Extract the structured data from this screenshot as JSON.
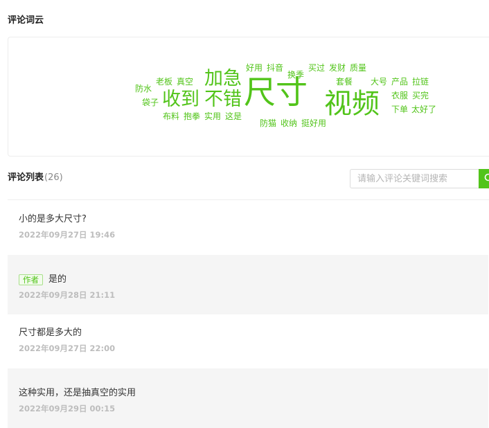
{
  "cloud_section": {
    "title": "评论词云",
    "words": [
      {
        "text": "尺寸",
        "size": 46
      },
      {
        "text": "视频",
        "size": 40
      },
      {
        "text": "收到",
        "size": 27
      },
      {
        "text": "不错",
        "size": 27
      },
      {
        "text": "加急",
        "size": 27
      },
      {
        "text": "防水",
        "size": 12
      },
      {
        "text": "袋子",
        "size": 12
      },
      {
        "text": "老板",
        "size": 12
      },
      {
        "text": "真空",
        "size": 12
      },
      {
        "text": "布料",
        "size": 12
      },
      {
        "text": "抱拳",
        "size": 12
      },
      {
        "text": "实用",
        "size": 12
      },
      {
        "text": "这是",
        "size": 12
      },
      {
        "text": "好用",
        "size": 12
      },
      {
        "text": "抖音",
        "size": 12
      },
      {
        "text": "换季",
        "size": 12
      },
      {
        "text": "买过",
        "size": 12
      },
      {
        "text": "发财",
        "size": 12
      },
      {
        "text": "质量",
        "size": 12
      },
      {
        "text": "套餐",
        "size": 12
      },
      {
        "text": "大号",
        "size": 12
      },
      {
        "text": "产品",
        "size": 12
      },
      {
        "text": "拉链",
        "size": 12
      },
      {
        "text": "衣服",
        "size": 12
      },
      {
        "text": "买完",
        "size": 12
      },
      {
        "text": "下单",
        "size": 12
      },
      {
        "text": "太好了",
        "size": 12
      },
      {
        "text": "防猫",
        "size": 12
      },
      {
        "text": "收纳",
        "size": 12
      },
      {
        "text": "挺好用",
        "size": 12
      }
    ]
  },
  "list_section": {
    "title": "评论列表",
    "count": "(26)",
    "search_placeholder": "请输入评论关键词搜索",
    "comments": [
      {
        "text": "小的是多大尺寸?",
        "time": "2022年09月27日 19:46",
        "is_reply": false
      },
      {
        "badge": "作者",
        "text": "是的",
        "time": "2022年09月28日 21:11",
        "is_reply": true
      },
      {
        "text": "尺寸都是多大的",
        "time": "2022年09月27日 22:00",
        "is_reply": false
      },
      {
        "text": "这种实用，还是抽真空的实用",
        "time": "2022年09月29日 00:15",
        "is_reply": true
      }
    ]
  },
  "colors": {
    "accent": "#52c41a",
    "reply_background": "#f5f5f5",
    "time_text": "#bdbdbd"
  },
  "icons": {
    "search_button": "search-icon"
  }
}
